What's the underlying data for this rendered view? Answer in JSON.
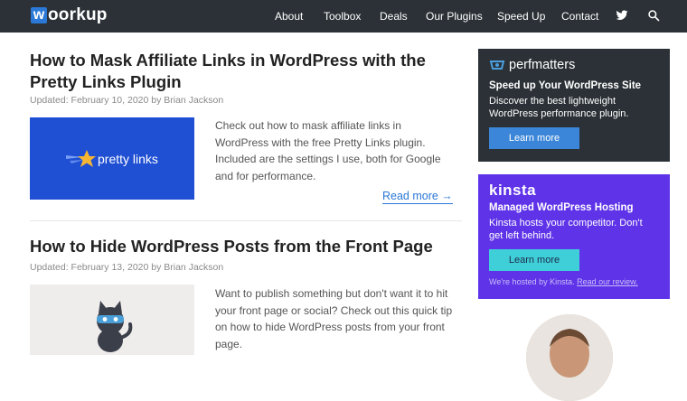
{
  "header": {
    "logo_letter": "w",
    "logo_rest": "oorkup",
    "nav": [
      "About",
      "Toolbox",
      "Deals",
      "Our Plugins",
      "Speed Up",
      "Contact"
    ],
    "twitter_icon": "twitter-icon",
    "search_icon": "search-icon"
  },
  "posts": [
    {
      "title": "How to Mask Affiliate Links in WordPress with the Pretty Links Plugin",
      "meta": "Updated: February 10, 2020 by Brian Jackson",
      "thumb_text": "pretty links",
      "excerpt": "Check out how to mask affiliate links in WordPress with the free Pretty Links plugin. Included are the settings I use, both for Google and for performance.",
      "read_more": "Read more →"
    },
    {
      "title": "How to Hide WordPress Posts from the Front Page",
      "meta": "Updated: February 13, 2020 by Brian Jackson",
      "excerpt": "Want to publish something but don't want it to hit your front page or social? Check out this quick tip on how to hide WordPress posts from your front page."
    }
  ],
  "sidebar": {
    "perfmatters": {
      "brand": "perfmatters",
      "headline": "Speed up Your WordPress Site",
      "text": "Discover the best lightweight WordPress performance plugin.",
      "button": "Learn more"
    },
    "kinsta": {
      "brand": "kinsta",
      "headline": "Managed WordPress Hosting",
      "text": "Kinsta hosts your competitor. Don't get left behind.",
      "button": "Learn more",
      "footer": "We're hosted by Kinsta.",
      "footer_link": "Read our review."
    }
  },
  "colors": {
    "header_bg": "#2b3136",
    "accent_blue": "#2b78d6",
    "kinsta_purple": "#5f33e8",
    "kinsta_button": "#3fcfd8",
    "perf_button": "#3b86d8"
  }
}
